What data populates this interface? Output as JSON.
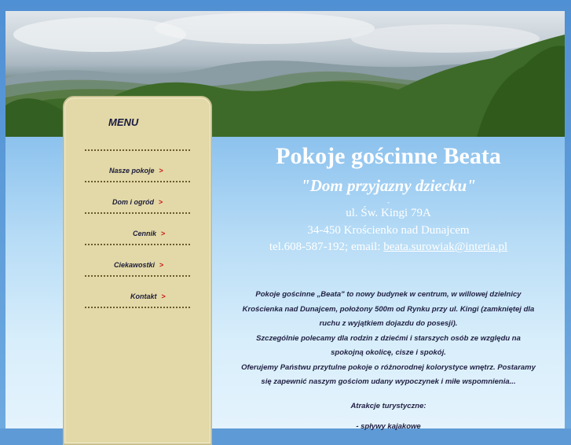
{
  "menu": {
    "title": "MENU",
    "items": [
      {
        "label": "Nasze pokoje",
        "arrow": ">"
      },
      {
        "label": "Dom i ogród",
        "arrow": ">"
      },
      {
        "label": "Cennik",
        "arrow": ">"
      },
      {
        "label": "Ciekawostki",
        "arrow": ">"
      },
      {
        "label": "Kontakt",
        "arrow": ">"
      }
    ]
  },
  "header": {
    "title": "Pokoje gościnne Beata",
    "tagline": "\"Dom przyjazny dziecku\"",
    "dash": "-"
  },
  "address": {
    "street": "ul. Św. Kingi 79A",
    "city": "34-450 Krościenko nad Dunajcem",
    "phone_prefix": "tel.608-587-192; email: ",
    "email": "beata.surowiak@interia.pl"
  },
  "description": {
    "lines": [
      "Pokoje gościnne „Beata\" to nowy budynek w centrum, w willowej dzielnicy",
      "Krościenka nad Dunajcem, położony 500m od Rynku przy ul. Kingi (zamkniętej dla",
      "ruchu z wyjątkiem dojazdu do posesji).",
      "Szczególnie polecamy dla rodzin z dziećmi i starszych osób ze względu na",
      "spokojną okolicę, cisze i spokój.",
      "Oferujemy Państwu przytulne pokoje o różnorodnej kolorystyce wnętrz. Postaramy",
      "się zapewnić naszym gościom udany wypoczynek i miłe wspomnienia..."
    ],
    "attractions_heading": "Atrakcje turystyczne:",
    "attraction_first": "- spływy kajakowe"
  },
  "colors": {
    "menu_bg": "#e3d9a8",
    "arrow": "#c81818",
    "title": "#ffffff",
    "body_text": "#222244"
  }
}
